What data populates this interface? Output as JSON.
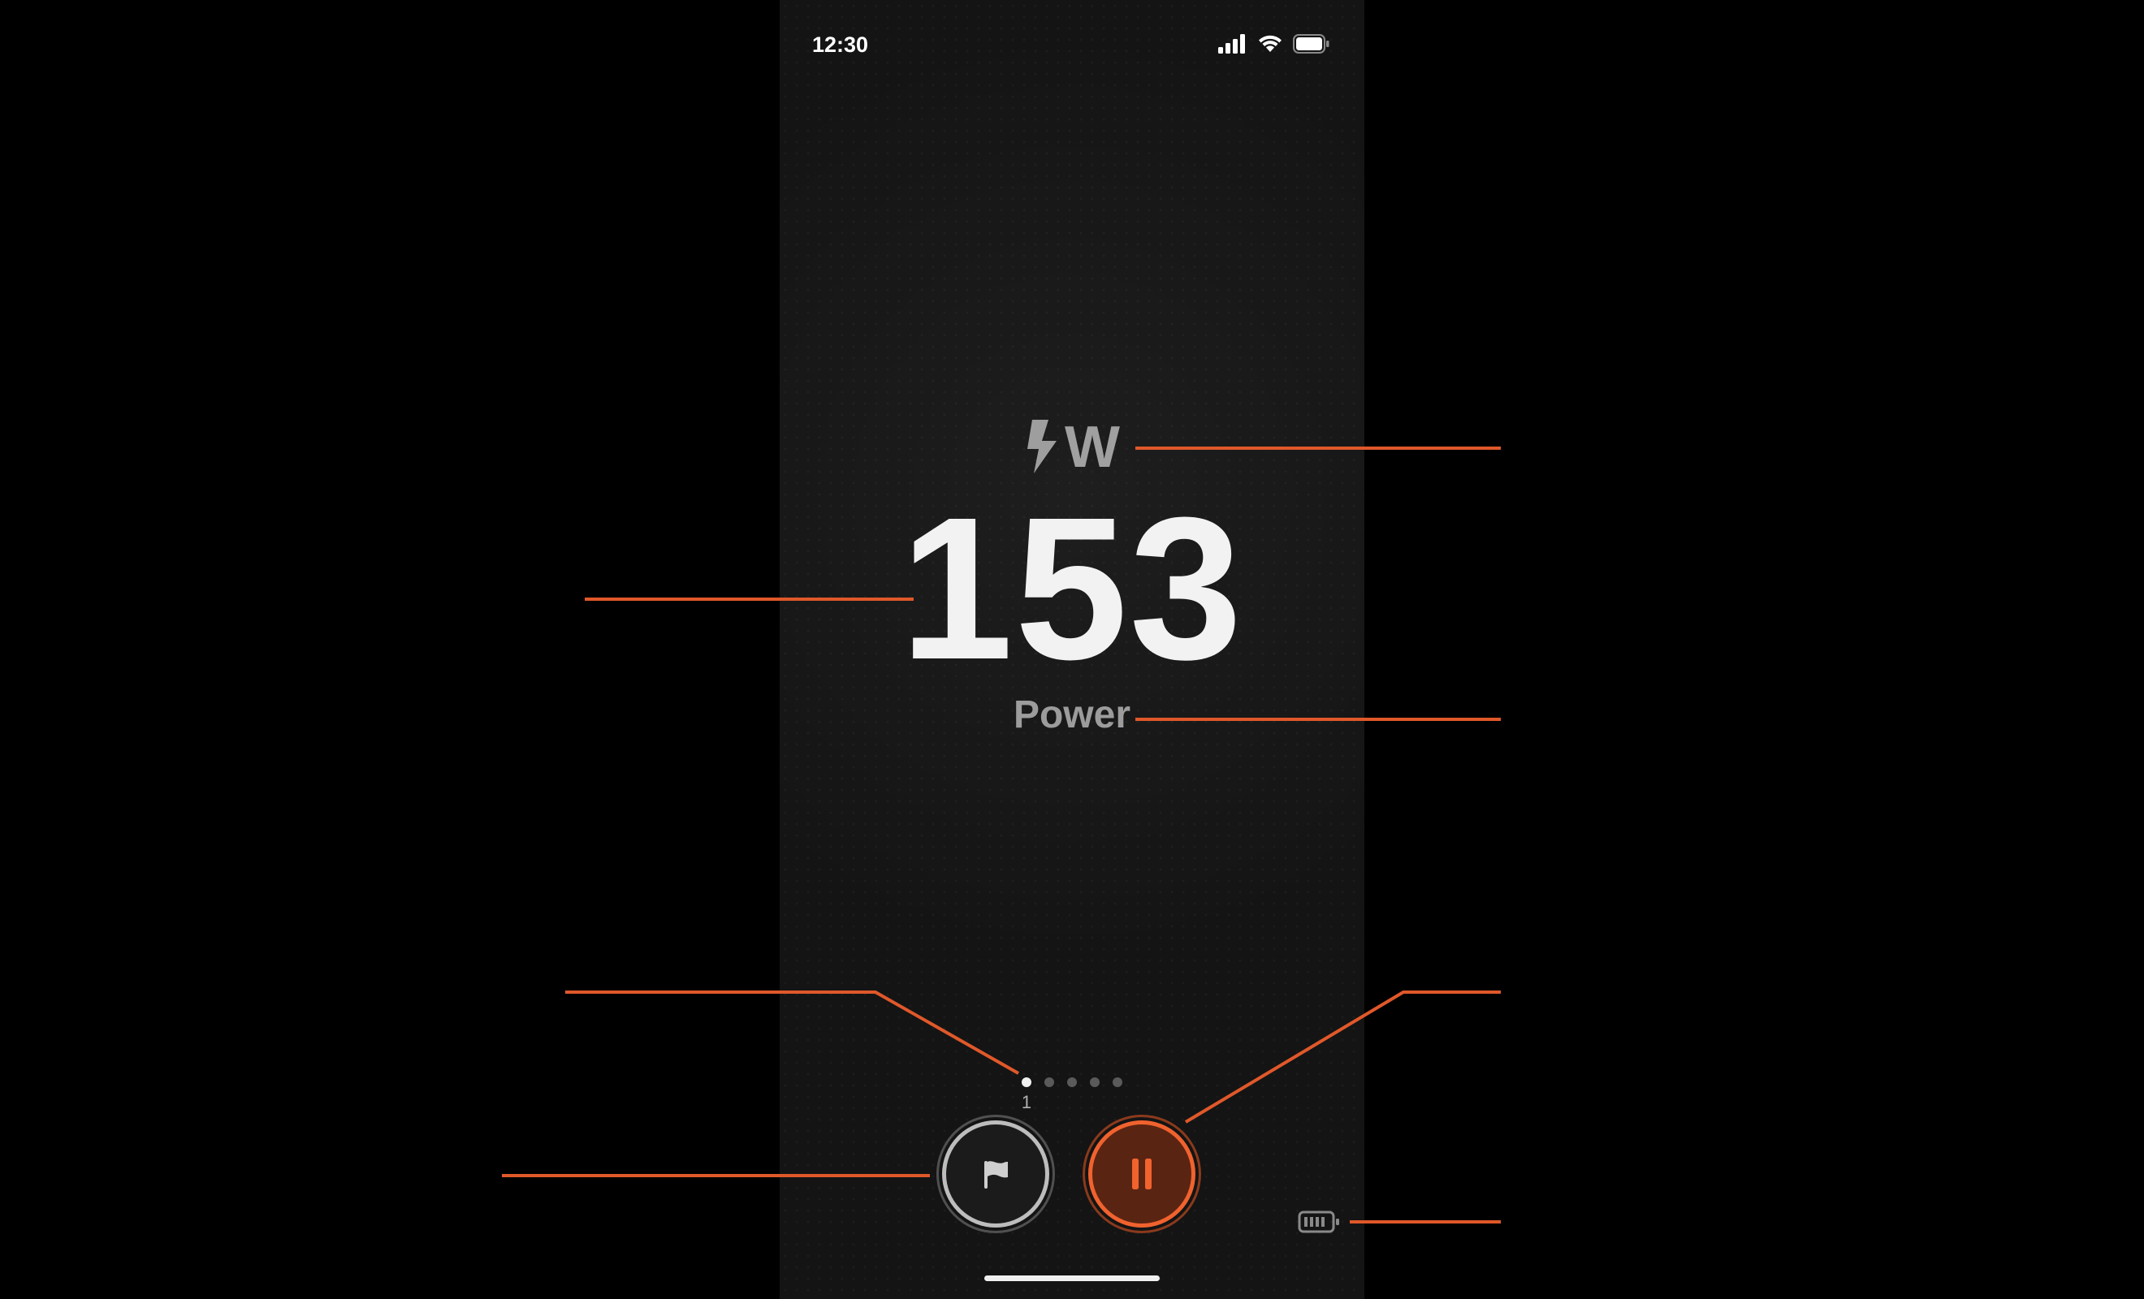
{
  "status_bar": {
    "time": "12:30"
  },
  "metric": {
    "unit": "W",
    "unit_icon": "lightning-bolt-icon",
    "value": "153",
    "label": "Power"
  },
  "pager": {
    "page_count": 5,
    "active_index": 0,
    "current_page_label": "1"
  },
  "controls": {
    "lap_icon": "flag-icon",
    "pause_icon": "pause-icon",
    "battery_icon": "sensor-battery-icon"
  },
  "colors": {
    "accent": "#f0622e",
    "background": "#141414",
    "value_text": "#f2f2f2",
    "secondary_text": "#9c9c9c"
  }
}
